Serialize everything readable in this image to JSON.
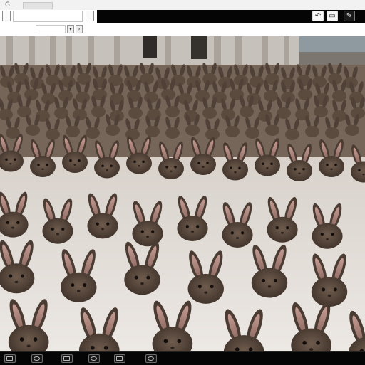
{
  "window": {
    "title_fragment": "Gl"
  },
  "toolbar": {
    "icons": [
      "back-icon",
      "image-icon",
      "edit-icon"
    ],
    "dark_strip_color": "#050505"
  },
  "addressbar": {
    "label": "",
    "input_value": ""
  },
  "viewer": {
    "scene_colors": {
      "building": "#c6c1bb",
      "crowd": "#6a5a4d",
      "floor": "#e6e1dc",
      "rabbit": "#5a4a3e",
      "ear_inner": "#b98a82"
    }
  },
  "taskbar": {
    "items": [
      "app-1-icon",
      "app-2-icon",
      "app-3-icon",
      "app-4-icon",
      "app-5-icon",
      "app-6-icon"
    ]
  }
}
